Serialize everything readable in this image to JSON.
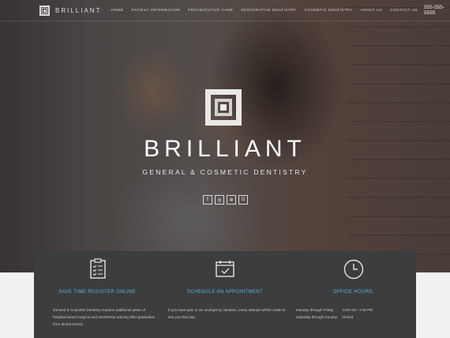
{
  "nav": {
    "logo_text": "BRILLIANT",
    "links": [
      "HOME",
      "PATIENT INFORMATION",
      "PREVENTATIVE CARE",
      "RESTORATIVE DENTISTRY",
      "COSMETIC DENTISTRY",
      "ABOUT US",
      "CONTACT US"
    ],
    "phone": "555-555-5555"
  },
  "hero": {
    "brand": "BRILLIANT",
    "tagline": "GENERAL & COSMETIC DENTISTRY",
    "socials": [
      "f",
      "◎",
      "✲",
      "G"
    ]
  },
  "cards": {
    "register": {
      "title": "SAVE TIME REGISTER ONLINE",
      "text": "General & Cosmetic Dentistry requires additional years of hospital-based surgical and anesthesia training after graduation from dental school."
    },
    "appointment": {
      "title": "SCHEDULE AN APPOINTMENT",
      "text": "If you have pain or an emergency situation, every attempt will be made to see you that day."
    },
    "hours": {
      "title": "OFFICE HOURS",
      "rows": [
        {
          "days": "Monday through Friday:",
          "time": "8:00 AM - 4:30 PM"
        },
        {
          "days": "Saturday through Sunday:",
          "time": "Closed"
        }
      ]
    }
  },
  "colors": {
    "accent": "#57b7d6",
    "panel": "#3c3d3f"
  }
}
